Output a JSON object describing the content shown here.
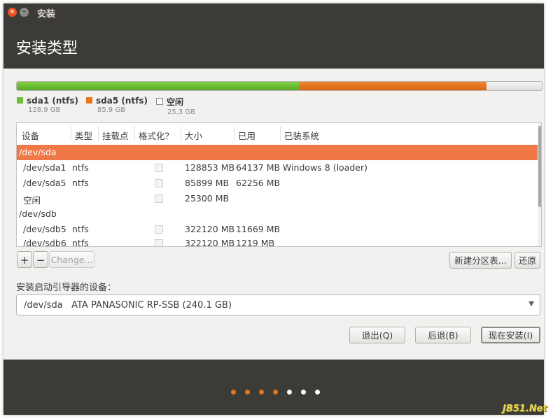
{
  "window": {
    "title": "安装",
    "close_glyph": "×",
    "min_glyph": "–"
  },
  "header": {
    "title": "安装类型"
  },
  "colors": {
    "sda1": "#6ac033",
    "sda5": "#e8741d",
    "free": "#ededed",
    "selected_row": "#f07746",
    "dot_active": "#e8741d",
    "dot_inactive": "#ffffff"
  },
  "legend": [
    {
      "name": "sda1 (ntfs)",
      "size": "128.9 GB"
    },
    {
      "name": "sda5 (ntfs)",
      "size": "85.9 GB"
    },
    {
      "name": "空闲",
      "size": "25.3 GB"
    }
  ],
  "disk_usage_gb": [
    128.9,
    85.9,
    25.3
  ],
  "table": {
    "headers": [
      "设备",
      "类型",
      "挂载点",
      "格式化？",
      "大小",
      "已用",
      "已装系统"
    ],
    "rows": [
      {
        "device": "/dev/sda",
        "type": "",
        "mount": "",
        "size": "",
        "used": "",
        "system": ""
      },
      {
        "device": "/dev/sda1",
        "type": "ntfs",
        "mount": "",
        "size": "128853 MB",
        "used": "64137 MB",
        "system": "Windows 8 (loader)"
      },
      {
        "device": "/dev/sda5",
        "type": "ntfs",
        "mount": "",
        "size": "85899 MB",
        "used": "62256 MB",
        "system": ""
      },
      {
        "device": "空闲",
        "type": "",
        "mount": "",
        "size": "25300 MB",
        "used": "",
        "system": ""
      },
      {
        "device": "/dev/sdb",
        "type": "",
        "mount": "",
        "size": "",
        "used": "",
        "system": ""
      },
      {
        "device": "/dev/sdb5",
        "type": "ntfs",
        "mount": "",
        "size": "322120 MB",
        "used": "11669 MB",
        "system": ""
      },
      {
        "device": "/dev/sdb6",
        "type": "ntfs",
        "mount": "",
        "size": "322120 MB",
        "used": "1219 MB",
        "system": ""
      }
    ]
  },
  "toolbar": {
    "add": "+",
    "remove": "−",
    "change": "Change...",
    "new_table": "新建分区表...",
    "revert": "还原"
  },
  "boot": {
    "label": "安装启动引导器的设备：",
    "device": "/dev/sda",
    "model": "ATA PANASONIC RP-SSB (240.1 GB)",
    "arrow": "▼"
  },
  "buttons": {
    "quit": "退出(Q)",
    "back": "后退(B)",
    "install": "现在安装(I)"
  },
  "progress": {
    "total_steps": 7,
    "completed_steps": 4
  },
  "watermark": "JB51.Net"
}
